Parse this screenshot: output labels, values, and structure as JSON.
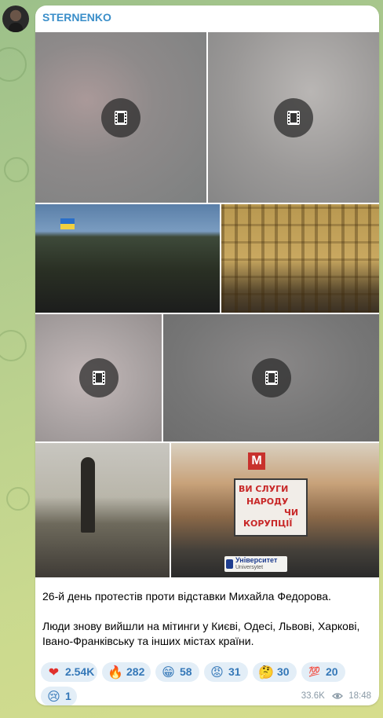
{
  "channel": {
    "name": "STERNENKO"
  },
  "media": [
    {
      "kind": "video",
      "icon": "film-icon"
    },
    {
      "kind": "video",
      "icon": "film-icon"
    },
    {
      "kind": "photo",
      "subject": "rally"
    },
    {
      "kind": "photo",
      "subject": "building"
    },
    {
      "kind": "video",
      "icon": "film-icon"
    },
    {
      "kind": "video",
      "icon": "film-icon"
    },
    {
      "kind": "photo",
      "subject": "statue"
    },
    {
      "kind": "photo",
      "subject": "university"
    }
  ],
  "photo_text": {
    "banner_line1": "ВИ СЛУГИ",
    "banner_line2": "НАРОДУ",
    "banner_line3": "ЧИ",
    "banner_line4": "КОРУПЦІЇ",
    "metro_letter": "М",
    "sign_line1": "Університет",
    "sign_line2": "Universytet"
  },
  "caption": {
    "line1": "26-й день протестів проти відставки Михайла Федорова.",
    "line2": "Люди знову вийшли на мітинги у Києві, Одесі, Львові, Харкові, Івано-Франківську та інших містах країни."
  },
  "reactions": [
    {
      "emoji": "❤",
      "count": "2.54K"
    },
    {
      "emoji": "🔥",
      "count": "282"
    },
    {
      "emoji": "😁",
      "count": "58"
    },
    {
      "emoji": "😡",
      "count": "31"
    },
    {
      "emoji": "🤔",
      "count": "30"
    },
    {
      "emoji": "💯",
      "count": "20"
    },
    {
      "emoji": "😢",
      "count": "1"
    }
  ],
  "meta": {
    "views": "33.6K",
    "time": "18:48"
  },
  "colors": {
    "accent": "#3a8ec9",
    "reaction_bg": "#e3eef7",
    "reaction_text": "#3578b8"
  }
}
